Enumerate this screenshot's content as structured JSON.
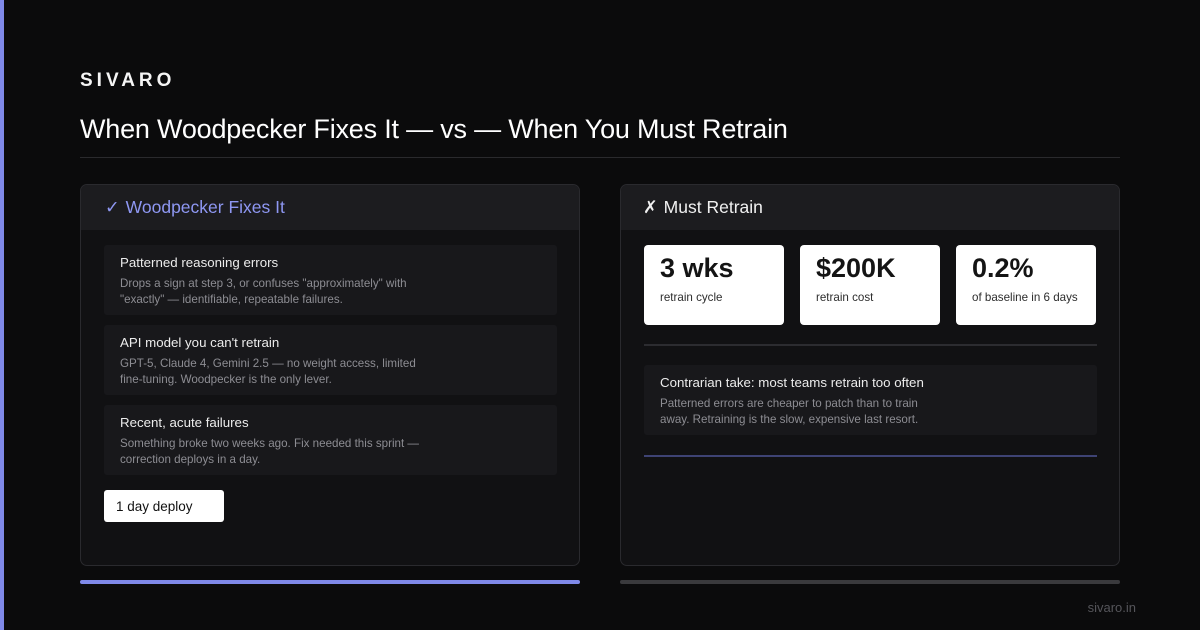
{
  "brand": "SIVARO",
  "title": "When Woodpecker Fixes It — vs — When You Must Retrain",
  "colors": {
    "accent": "#7f89e8",
    "background": "#0b0b0c",
    "card": "#111113",
    "card_header": "#1c1c1f"
  },
  "left_card": {
    "glyph": "✓",
    "title": "Woodpecker Fixes It",
    "items": [
      {
        "title": "Patterned reasoning errors",
        "desc": "Drops a sign at step 3, or confuses \"approximately\" with \"exactly\" — identifiable, repeatable failures."
      },
      {
        "title": "API model you can't retrain",
        "desc": "GPT-5, Claude 4, Gemini 2.5 — no weight access, limited fine-tuning. Woodpecker is the only lever."
      },
      {
        "title": "Recent, acute failures",
        "desc": "Something broke two weeks ago. Fix needed this sprint — correction deploys in a day."
      }
    ],
    "badge": "1 day deploy"
  },
  "right_card": {
    "glyph": "✗",
    "title": "Must Retrain",
    "stats": [
      {
        "value": "3 wks",
        "label": "retrain cycle"
      },
      {
        "value": "$200K",
        "label": "retrain cost"
      },
      {
        "value": "0.2%",
        "label": "of baseline in 6 days"
      }
    ],
    "take": {
      "title": "Contrarian take: most teams retrain too often",
      "desc": "Patterned errors are cheaper to patch than to train away. Retraining is the slow, expensive last resort."
    }
  },
  "footer": "sivaro.in"
}
